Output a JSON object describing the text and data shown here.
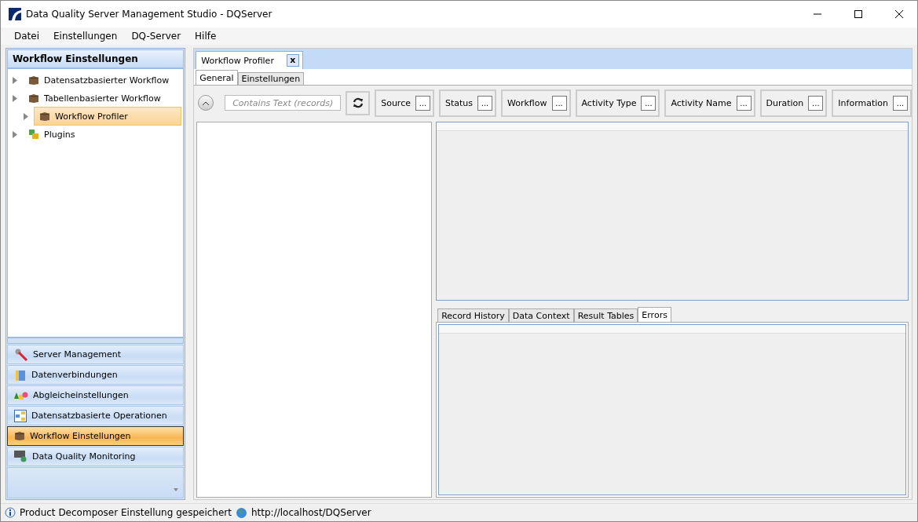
{
  "window": {
    "title": "Data Quality Server Management Studio - DQServer"
  },
  "menu": [
    "Datei",
    "Einstellungen",
    "DQ-Server",
    "Hilfe"
  ],
  "sidebar": {
    "title": "Workflow Einstellungen",
    "tree": [
      {
        "label": "Datensatzbasierter Workflow",
        "kind": "box",
        "selected": false
      },
      {
        "label": "Tabellenbasierter Workflow",
        "kind": "box",
        "selected": false
      },
      {
        "label": "Workflow Profiler",
        "kind": "box",
        "selected": true
      },
      {
        "label": "Plugins",
        "kind": "plugin",
        "selected": false
      }
    ],
    "nav": [
      {
        "label": "Server Management",
        "kind": "wrench",
        "selected": false
      },
      {
        "label": "Datenverbindungen",
        "kind": "database",
        "selected": false
      },
      {
        "label": "Abgleicheinstellungen",
        "kind": "shapes",
        "selected": false
      },
      {
        "label": "Datensatzbasierte Operationen",
        "kind": "diagram",
        "selected": false
      },
      {
        "label": "Workflow Einstellungen",
        "kind": "box",
        "selected": true
      },
      {
        "label": "Data Quality Monitoring",
        "kind": "monitor",
        "selected": false
      }
    ]
  },
  "document_tab": {
    "label": "Workflow Profiler",
    "close": "x"
  },
  "sub_tabs": [
    {
      "label": "General",
      "selected": true
    },
    {
      "label": "Einstellungen",
      "selected": false
    }
  ],
  "filter": {
    "placeholder": "Contains Text (records)",
    "buttons": [
      {
        "label": "Source",
        "more": "..."
      },
      {
        "label": "Status",
        "more": "..."
      },
      {
        "label": "Workflow",
        "more": "..."
      },
      {
        "label": "Activity Type",
        "more": "..."
      },
      {
        "label": "Activity Name",
        "more": "..."
      },
      {
        "label": "Duration",
        "more": "..."
      },
      {
        "label": "Information",
        "more": "..."
      }
    ]
  },
  "bottom_tabs": [
    {
      "label": "Record History",
      "selected": false
    },
    {
      "label": "Data Context",
      "selected": false
    },
    {
      "label": "Result Tables",
      "selected": false
    },
    {
      "label": "Errors",
      "selected": true
    }
  ],
  "status_bar": {
    "message": "Product Decomposer Einstellung gespeichert",
    "url": "http://localhost/DQServer"
  }
}
